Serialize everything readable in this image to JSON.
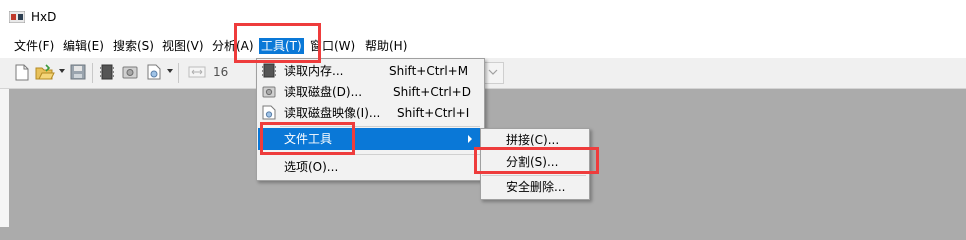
{
  "app": {
    "title": "HxD"
  },
  "menubar": {
    "items": [
      {
        "label": "文件(F)"
      },
      {
        "label": "编辑(E)"
      },
      {
        "label": "搜索(S)"
      },
      {
        "label": "视图(V)"
      },
      {
        "label": "分析(A)"
      },
      {
        "label": "工具(T)"
      },
      {
        "label": "窗口(W)"
      },
      {
        "label": "帮助(H)"
      }
    ]
  },
  "toolbar": {
    "bytes_per_row": "16"
  },
  "tools_menu": {
    "items": [
      {
        "label": "读取内存...",
        "shortcut": "Shift+Ctrl+M"
      },
      {
        "label": "读取磁盘(D)...",
        "shortcut": "Shift+Ctrl+D"
      },
      {
        "label": "读取磁盘映像(I)...",
        "shortcut": "Shift+Ctrl+I"
      },
      {
        "label": "文件工具"
      },
      {
        "label": "选项(O)..."
      }
    ]
  },
  "file_tools_submenu": {
    "items": [
      {
        "label": "拼接(C)..."
      },
      {
        "label": "分割(S)..."
      },
      {
        "label": "安全删除..."
      }
    ]
  },
  "colors": {
    "highlight": "#0a78d7",
    "annotation": "#ee3c3c",
    "workspace": "#ababab"
  }
}
